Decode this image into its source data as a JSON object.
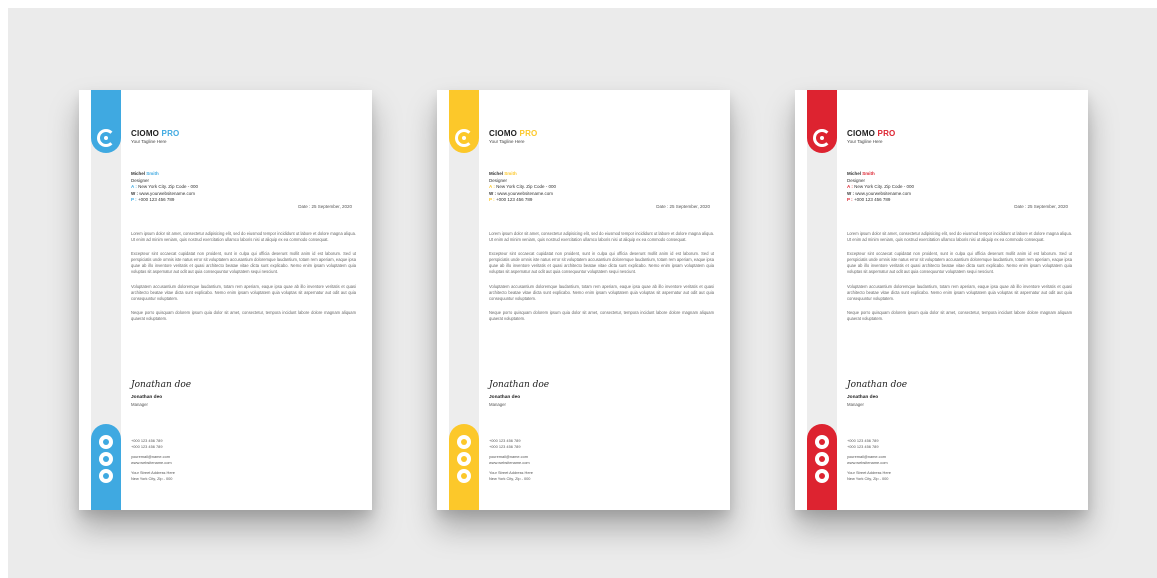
{
  "colors": {
    "blue": "#3fa9e1",
    "yellow": "#fcc82a",
    "red": "#dd2330"
  },
  "letterheads": [
    {
      "brand": "CIOMO",
      "brand_accent": "PRO",
      "tagline": "Your Tagline Here",
      "sender_first": "Michel",
      "sender_last": "Smith",
      "sender_role": "Designer",
      "address_label": "A :",
      "address": "New York City. Zip Code - 000",
      "web_label": "W :",
      "web": "www.yourwebsitename.com",
      "phone_label": "P :",
      "phone": "+000 123 456 789",
      "date": "Date : 25 September, 2020",
      "paragraphs": [
        "Lorem ipsum dolor sit amet, consectetur adipisicing elit, sed do eiusmod tempor incididunt ut labore et dolore magna aliqua. Ut enim ad minim veniam, quis nostrud exercitation ullamco laboris nisi ut aliquip ex ea commodo consequat.",
        "Excepteur sint occaecat cupidatat non proident, sunt in culpa qui officia deserunt mollit anim id est laborum. Sed ut perspiciatis unde omnis iste natus error sit voluptatem accusantium doloremque laudantium, totam rem aperiam, eaque ipsa quae ab illo inventore veritatis et quasi architecto beatae vitae dicta sunt explicabo. Nemo enim ipsam voluptatem quia voluptas sit aspernatur aut odit aut quia consequuntur voluptatem sequi nesciunt.",
        "Voluptatem accusantium doloremque laudantium, totam rem aperiam, eaque ipsa quae ab illo inventore veritatis et quasi architecto beatae vitae dicta sunt explicabo. Nemo enim ipsam voluptatem quia voluptas sit aspernatur aut odit aut quia consequuntur voluptatem.",
        "Neque porro quisquam dolorem ipsum quia dolor sit amet, consectetur, tempora incidunt labore dolore magnam aliquam quaerat voluptatem."
      ],
      "signature_script": "Jonathan doe",
      "signer_name": "Jonathan deo",
      "signer_role": "Manager",
      "contact_phone_1": "+000 123 456 789",
      "contact_phone_2": "+000 123 456 789",
      "contact_email": "youremail@name.com",
      "contact_web": "www.websitename.com",
      "contact_address_1": "Your Street Address Here",
      "contact_address_2": "New York City, Zip - 000"
    },
    {
      "brand": "CIOMO",
      "brand_accent": "PRO",
      "tagline": "Your Tagline Here",
      "sender_first": "Michel",
      "sender_last": "Smith",
      "sender_role": "Designer",
      "address_label": "A :",
      "address": "New York City. Zip Code - 000",
      "web_label": "W :",
      "web": "www.yourwebsitename.com",
      "phone_label": "P :",
      "phone": "+000 123 456 789",
      "date": "Date : 25 September, 2020",
      "paragraphs": [
        "Lorem ipsum dolor sit amet, consectetur adipisicing elit, sed do eiusmod tempor incididunt ut labore et dolore magna aliqua. Ut enim ad minim veniam, quis nostrud exercitation ullamco laboris nisi ut aliquip ex ea commodo consequat.",
        "Excepteur sint occaecat cupidatat non proident, sunt in culpa qui officia deserunt mollit anim id est laborum. Sed ut perspiciatis unde omnis iste natus error sit voluptatem accusantium doloremque laudantium, totam rem aperiam, eaque ipsa quae ab illo inventore veritatis et quasi architecto beatae vitae dicta sunt explicabo. Nemo enim ipsam voluptatem quia voluptas sit aspernatur aut odit aut quia consequuntur voluptatem sequi nesciunt.",
        "Voluptatem accusantium doloremque laudantium, totam rem aperiam, eaque ipsa quae ab illo inventore veritatis et quasi architecto beatae vitae dicta sunt explicabo. Nemo enim ipsam voluptatem quia voluptas sit aspernatur aut odit aut quia consequuntur voluptatem.",
        "Neque porro quisquam dolorem ipsum quia dolor sit amet, consectetur, tempora incidunt labore dolore magnam aliquam quaerat voluptatem."
      ],
      "signature_script": "Jonathan doe",
      "signer_name": "Jonathan deo",
      "signer_role": "Manager",
      "contact_phone_1": "+000 123 456 789",
      "contact_phone_2": "+000 123 456 789",
      "contact_email": "youremail@name.com",
      "contact_web": "www.websitename.com",
      "contact_address_1": "Your Street Address Here",
      "contact_address_2": "New York City, Zip - 000"
    },
    {
      "brand": "CIOMO",
      "brand_accent": "PRO",
      "tagline": "Your Tagline Here",
      "sender_first": "Michel",
      "sender_last": "Smith",
      "sender_role": "Designer",
      "address_label": "A :",
      "address": "New York City. Zip Code - 000",
      "web_label": "W :",
      "web": "www.yourwebsitename.com",
      "phone_label": "P :",
      "phone": "+000 123 456 789",
      "date": "Date : 25 September, 2020",
      "paragraphs": [
        "Lorem ipsum dolor sit amet, consectetur adipisicing elit, sed do eiusmod tempor incididunt ut labore et dolore magna aliqua. Ut enim ad minim veniam, quis nostrud exercitation ullamco laboris nisi ut aliquip ex ea commodo consequat.",
        "Excepteur sint occaecat cupidatat non proident, sunt in culpa qui officia deserunt mollit anim id est laborum. Sed ut perspiciatis unde omnis iste natus error sit voluptatem accusantium doloremque laudantium, totam rem aperiam, eaque ipsa quae ab illo inventore veritatis et quasi architecto beatae vitae dicta sunt explicabo. Nemo enim ipsam voluptatem quia voluptas sit aspernatur aut odit aut quia consequuntur voluptatem sequi nesciunt.",
        "Voluptatem accusantium doloremque laudantium, totam rem aperiam, eaque ipsa quae ab illo inventore veritatis et quasi architecto beatae vitae dicta sunt explicabo. Nemo enim ipsam voluptatem quia voluptas sit aspernatur aut odit aut quia consequuntur voluptatem.",
        "Neque porro quisquam dolorem ipsum quia dolor sit amet, consectetur, tempora incidunt labore dolore magnam aliquam quaerat voluptatem."
      ],
      "signature_script": "Jonathan doe",
      "signer_name": "Jonathan deo",
      "signer_role": "Manager",
      "contact_phone_1": "+000 123 456 789",
      "contact_phone_2": "+000 123 456 789",
      "contact_email": "youremail@name.com",
      "contact_web": "www.websitename.com",
      "contact_address_1": "Your Street Address Here",
      "contact_address_2": "New York City, Zip - 000"
    }
  ]
}
